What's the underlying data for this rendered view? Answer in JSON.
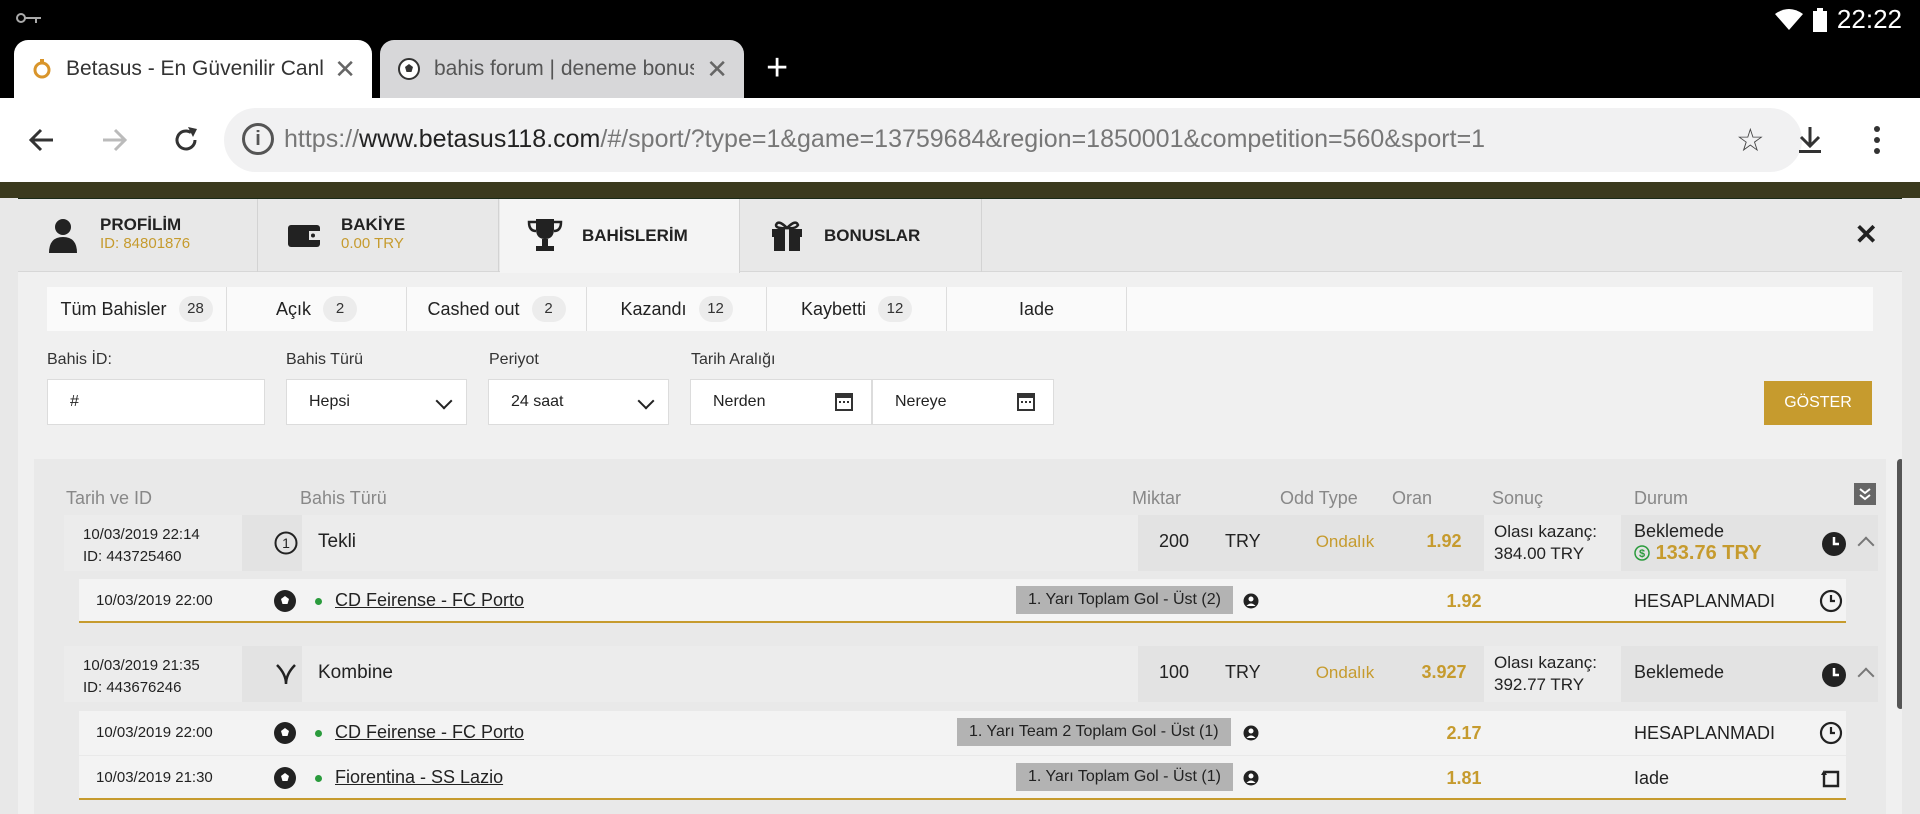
{
  "statusbar": {
    "time": "22:22"
  },
  "browser": {
    "tabs": [
      {
        "title": "Betasus - En Güvenilir Canlı Bahis",
        "favicon": "betasus-favicon-icon"
      },
      {
        "title": "bahis forum | deneme bonusu",
        "favicon": "soccer-ball-icon"
      }
    ],
    "url": {
      "scheme": "https://",
      "domain": "www.betasus118.com",
      "path": "/#/sport/?type=1&game=13759684&region=1850001&competition=560&sport=1"
    }
  },
  "account_tabs": {
    "profile": {
      "label": "PROFİLİM",
      "sub": "ID: 84801876"
    },
    "balance": {
      "label": "BAKİYE",
      "sub": "0.00 TRY"
    },
    "bets": {
      "label": "BAHİSLERİM"
    },
    "bonuses": {
      "label": "BONUSLAR"
    }
  },
  "filter_tabs": [
    {
      "label": "Tüm Bahisler",
      "count": "28"
    },
    {
      "label": "Açık",
      "count": "2"
    },
    {
      "label": "Cashed out",
      "count": "2"
    },
    {
      "label": "Kazandı",
      "count": "12"
    },
    {
      "label": "Kaybetti",
      "count": "12"
    },
    {
      "label": "Iade",
      "count": ""
    }
  ],
  "filters": {
    "bet_id": {
      "label": "Bahis İD:",
      "value": "#"
    },
    "bet_type": {
      "label": "Bahis Türü",
      "value": "Hepsi"
    },
    "period": {
      "label": "Periyot",
      "value": "24 saat"
    },
    "date_range": {
      "label": "Tarih Aralığı",
      "from": "Nerden",
      "to": "Nereye"
    },
    "show_button": "GÖSTER"
  },
  "table_headers": {
    "date_id": "Tarih ve ID",
    "bet_type": "Bahis Türü",
    "amount": "Miktar",
    "odd_type": "Odd Type",
    "odds": "Oran",
    "result": "Sonuç",
    "status": "Durum"
  },
  "bets": [
    {
      "date": "10/03/2019 22:14",
      "id": "ID: 443725460",
      "type": "Tekli",
      "amount": "200",
      "currency": "TRY",
      "odd_type": "Ondalık",
      "odds": "1.92",
      "result_label": "Olası kazanç:",
      "result_value": "384.00 TRY",
      "status": "Beklemede",
      "cashout": "133.76 TRY",
      "events": [
        {
          "date": "10/03/2019 22:00",
          "match": "CD Feirense - FC Porto",
          "market": "1. Yarı Toplam Gol - Üst (2)",
          "odds": "1.92",
          "status": "HESAPLANMADI"
        }
      ]
    },
    {
      "date": "10/03/2019 21:35",
      "id": "ID: 443676246",
      "type": "Kombine",
      "amount": "100",
      "currency": "TRY",
      "odd_type": "Ondalık",
      "odds": "3.927",
      "result_label": "Olası kazanç:",
      "result_value": "392.77 TRY",
      "status": "Beklemede",
      "events": [
        {
          "date": "10/03/2019 22:00",
          "match": "CD Feirense - FC Porto",
          "market": "1. Yarı Team 2 Toplam Gol - Üst (1)",
          "odds": "2.17",
          "status": "HESAPLANMADI"
        },
        {
          "date": "10/03/2019 21:30",
          "match": "Fiorentina - SS Lazio",
          "market": "1. Yarı Toplam Gol - Üst (1)",
          "odds": "1.81",
          "status": "Iade"
        }
      ]
    }
  ],
  "colors": {
    "accent": "#c69b2e",
    "live_dot": "#2a9b3c"
  }
}
